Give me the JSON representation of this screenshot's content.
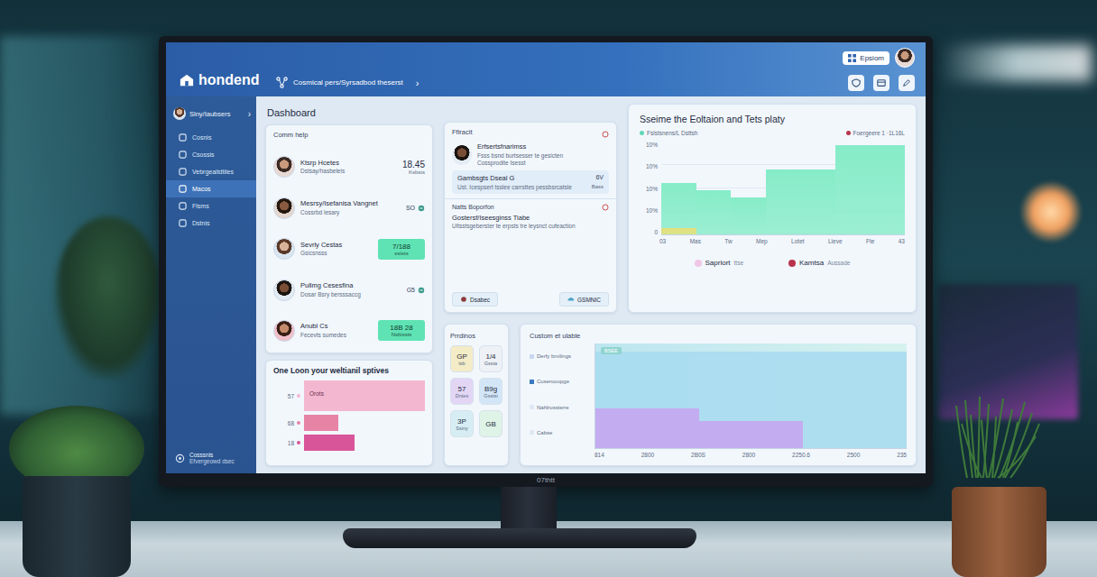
{
  "monitor": {
    "brand": "07thtt"
  },
  "header": {
    "logo": "hondend",
    "breadcrumb": "Cosmical pers/Syrsadbod theserst",
    "breadcrumb_chevron": "›",
    "user": "Epsiom"
  },
  "sidebar": {
    "title": "Slny/Iaubsers",
    "chevron": "›",
    "items": [
      {
        "label": "Cosnis",
        "selected": false
      },
      {
        "label": "Csossis",
        "selected": false
      },
      {
        "label": "Vebrgeaitdtiles",
        "selected": false
      },
      {
        "label": "Macos",
        "selected": true
      },
      {
        "label": "Flsms",
        "selected": false
      },
      {
        "label": "Dstnis",
        "selected": false
      }
    ],
    "footer": {
      "title": "Cosssnis",
      "subtitle": "Efvergeowd dsec"
    }
  },
  "page_title": "Dashboard",
  "people_card": {
    "title": "Comm help",
    "rows": [
      {
        "name": "Ktsrp Hcetes",
        "detail": "Dstsay/hasbeleis",
        "value": "18.45",
        "sub": "Ksbsts",
        "kind": "plain"
      },
      {
        "name": "Mesrsy/Isefanisa Vangnet",
        "detail": "Cossrbd lesary",
        "value": "SO",
        "kind": "icon"
      },
      {
        "name": "Sevrly Cestas",
        "detail": "Gsicsnsss",
        "value": "7/188",
        "sub": "sslets",
        "kind": "badge"
      },
      {
        "name": "Pullmg Cesesfina",
        "detail": "Dosar Bsry bersssaccg",
        "value": "G5",
        "kind": "icon"
      },
      {
        "name": "Anubl Cs",
        "detail": "Fecevts sumedes",
        "value": "18B 28",
        "sub": "Nsbissts",
        "kind": "badge"
      }
    ]
  },
  "bars_card": {
    "title": "One Loon your weltianil sptives",
    "bars": [
      {
        "label": "57",
        "level": 1.0,
        "text": "Orots",
        "color": "#f3b8d0"
      },
      {
        "label": "68",
        "level": 0.28,
        "color": "#e784a6"
      },
      {
        "label": "18",
        "level": 0.42,
        "color": "#d9559a"
      }
    ]
  },
  "activity_card": {
    "title": "Ffiracit",
    "person": {
      "name": "Erfsertsfnarimss",
      "lines": [
        "Fsss bsnd burtsesser te gesicten",
        "Cossprodite Isesst"
      ]
    },
    "highlight": {
      "title": "Gambsgts Dseal G",
      "value": "6V",
      "detail": "Ust. Icespsert tsslee carrsttes pessbsrcatsle",
      "sub": "Bass"
    },
    "section": {
      "title": "Natts Boporfon",
      "name": "Gostersf/Iseesginss Tiabe",
      "detail": "Ultsstsgeberster te erpsts tre leysnct cufeaction",
      "buttons": [
        "Dsabec",
        "GSMNIC"
      ]
    }
  },
  "tiles_card": {
    "title": "Prrdinos",
    "tiles": [
      {
        "value": "GP",
        "label": "tsb",
        "color": "#f3ecc6"
      },
      {
        "value": "1/4",
        "label": "Gssta",
        "color": "#eef1f5"
      },
      {
        "value": "57",
        "label": "Dntes",
        "color": "#e3d6f5"
      },
      {
        "value": "B9g",
        "label": "Gsstsi",
        "color": "#d3e6f7"
      },
      {
        "value": "3P",
        "label": "Ssiny",
        "color": "#d6eef3"
      },
      {
        "value": "GB",
        "label": "",
        "color": "#dff3e6"
      }
    ]
  },
  "trend_chart": {
    "title": "Sseime the Eoltaion and Tets platy",
    "legend_top": [
      {
        "label": "Fslstsnens/L Dsttsh",
        "color": "#5fd8b8"
      },
      {
        "label": "Foergeere 1 ·1L16L",
        "color": "#b8344c"
      }
    ],
    "y_ticks": [
      "10%",
      "10%",
      "10%",
      "10%",
      "0"
    ],
    "x_labels": [
      "03",
      "Mas",
      "Tw",
      "Mep",
      "Lotet",
      "Lieve",
      "Fte",
      "43"
    ],
    "series": [
      {
        "values": [
          55,
          48,
          40,
          70,
          70,
          96,
          96
        ],
        "color": "#86ecc8"
      },
      {
        "values": [
          7,
          0,
          0,
          0,
          0,
          0,
          0
        ],
        "color": "#e6e07a"
      }
    ],
    "legend_bottom": [
      {
        "label": "Saprlort",
        "sub": "ttse",
        "color": "#f0c6e6"
      },
      {
        "label": "Kamtsa",
        "sub": "Aussade",
        "color": "#b8344c"
      }
    ]
  },
  "custom_chart": {
    "title": "Custom et ulable",
    "tag": "BSEE",
    "legend": [
      {
        "label": "Derfy bmilings",
        "color": "#c8d8ee"
      },
      {
        "label": "Cuserooupge",
        "color": "#3a78c0"
      },
      {
        "label": "Nahlrusstsrre",
        "color": "#dfe8f2"
      },
      {
        "label": "Cabse",
        "color": "#dfe8f2"
      }
    ],
    "x_labels": [
      "814",
      "2800",
      "2B0S",
      "2800",
      "2250.6",
      "2500",
      "235"
    ],
    "series": [
      {
        "values": [
          92,
          92,
          92,
          92,
          92,
          92
        ],
        "color": "#a9dcef"
      },
      {
        "values": [
          38,
          38,
          26,
          26,
          0,
          0
        ],
        "color": "#c6a6ef"
      }
    ]
  }
}
